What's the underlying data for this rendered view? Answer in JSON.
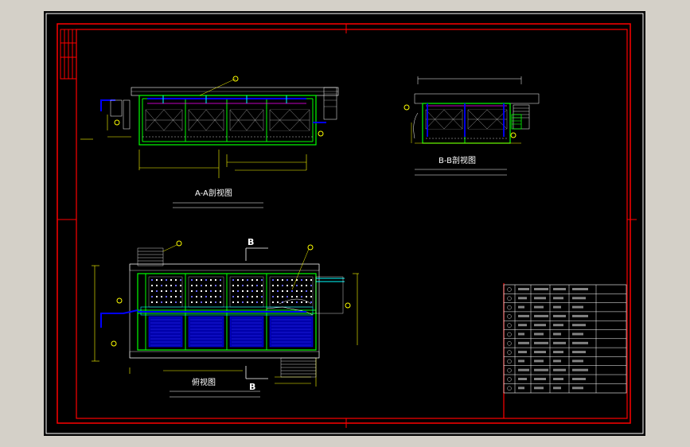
{
  "views": {
    "aa_title": "A-A剖视图",
    "bb_title": "B-B剖视图",
    "plan_title": "俯视图",
    "section_mark_top": "B",
    "section_mark_bottom": "B"
  },
  "colors": {
    "background_outer": "#d4d0c8",
    "sheet": "#000000",
    "frame_red": "#ff0000",
    "frame_white": "#ffffff",
    "tank_green": "#00ff00",
    "pipe_blue": "#0000ff",
    "dim_yellow": "#ffff00",
    "line_cyan": "#00ffff",
    "highlight_magenta": "#ff00ff"
  },
  "icons": {
    "balloon": "circle-callout-icon",
    "stair": "stair-hatch-icon",
    "filter_media": "cross-hatch-icon"
  }
}
